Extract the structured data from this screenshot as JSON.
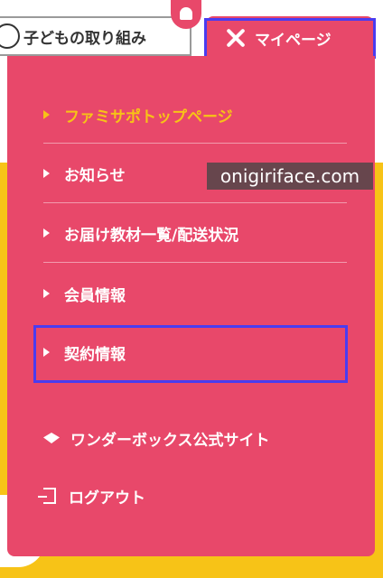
{
  "header": {
    "kids_tab_label": "子どもの取り組み",
    "mypage_tab_label": "マイページ"
  },
  "menu": {
    "items": [
      {
        "label": "ファミサポトップページ",
        "active": true
      },
      {
        "label": "お知らせ"
      },
      {
        "label": "お届け教材一覧/配送状況"
      },
      {
        "label": "会員情報"
      },
      {
        "label": "契約情報"
      }
    ],
    "links": [
      {
        "label": "ワンダーボックス公式サイト",
        "icon": "wonderbox-logo-icon"
      },
      {
        "label": "ログアウト",
        "icon": "logout-icon"
      }
    ]
  },
  "watermark": "onigiriface.com",
  "colors": {
    "menu_bg": "#e8486a",
    "active_text": "#f7c317",
    "page_bg": "#f7c317",
    "highlight": "#4a3cf0"
  }
}
